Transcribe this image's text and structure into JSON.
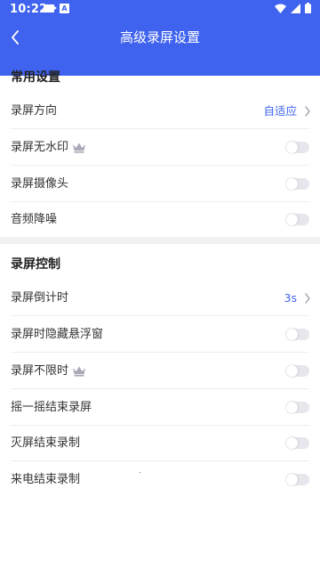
{
  "statusbar": {
    "time": "10:22"
  },
  "header": {
    "title": "高级录屏设置"
  },
  "sections": [
    {
      "title": "常用设置",
      "rows": [
        {
          "label": "录屏方向",
          "value": "自适应"
        },
        {
          "label": "录屏无水印"
        },
        {
          "label": "录屏摄像头"
        },
        {
          "label": "音频降噪"
        }
      ]
    },
    {
      "title": "录屏控制",
      "rows": [
        {
          "label": "录屏倒计时",
          "value": "3s"
        },
        {
          "label": "录屏时隐藏悬浮窗"
        },
        {
          "label": "录屏不限时"
        },
        {
          "label": "摇一摇结束录屏"
        },
        {
          "label": "灭屏结束录制"
        },
        {
          "label": "来电结束录制"
        }
      ]
    }
  ],
  "colors": {
    "accent": "#3f63ee",
    "toggle_off": "#e6e6ec",
    "crown": "#9a9aa8"
  }
}
